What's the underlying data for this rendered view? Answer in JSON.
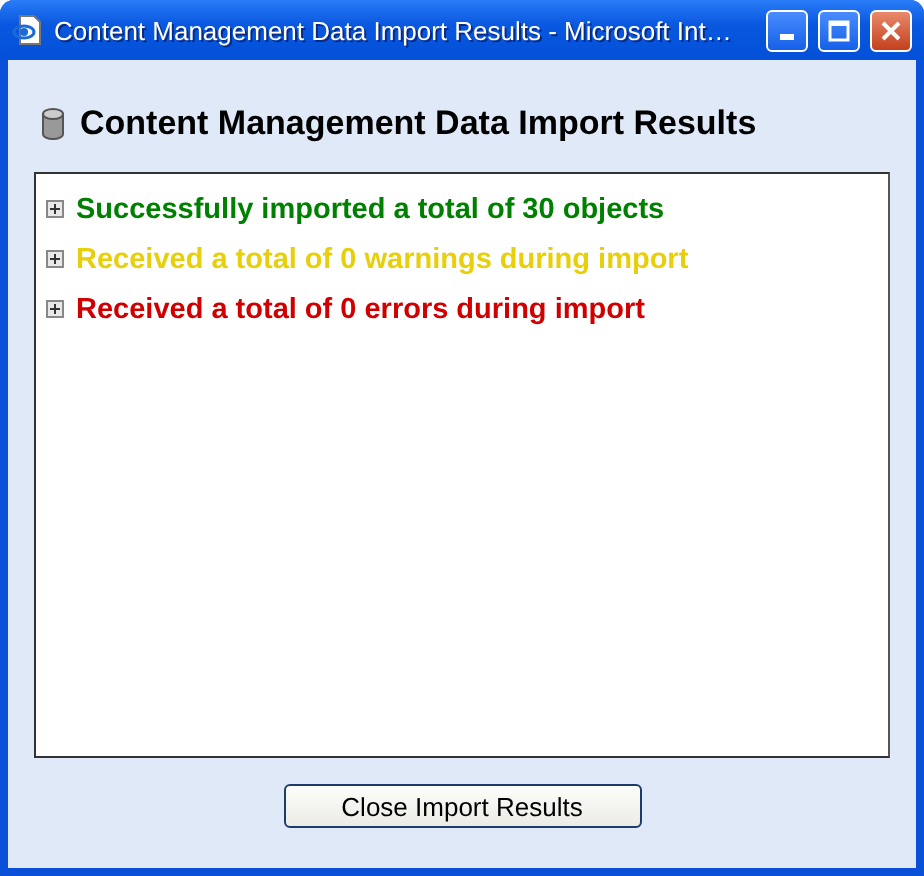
{
  "window": {
    "title": "Content Management Data Import Results - Microsoft Int…"
  },
  "heading": "Content Management Data Import Results",
  "results": [
    {
      "text": "Successfully imported a total of 30 objects",
      "color": "#008000",
      "expanded": false
    },
    {
      "text": "Received a total of 0 warnings during import",
      "color": "#e8cf0c",
      "expanded": false
    },
    {
      "text": "Received a total of 0 errors during import",
      "color": "#d00000",
      "expanded": false
    }
  ],
  "button": "Close Import Results"
}
